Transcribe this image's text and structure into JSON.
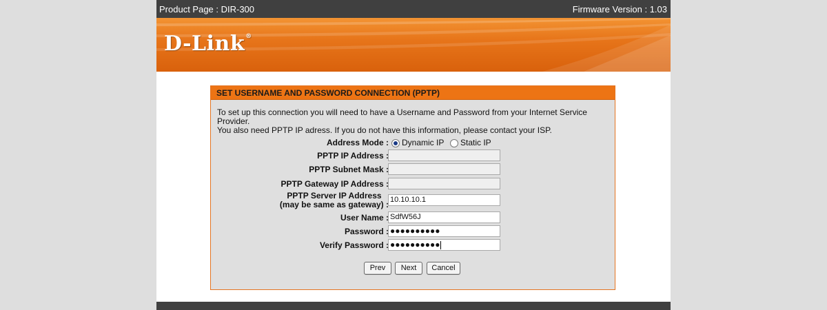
{
  "topbar": {
    "product_page": "Product Page : DIR-300",
    "firmware": "Firmware Version : 1.03"
  },
  "brand": {
    "logo_text": "D-Link",
    "logo_mark": "®",
    "accent": "#e7751a"
  },
  "panel": {
    "title": "SET USERNAME AND PASSWORD CONNECTION (PPTP)",
    "desc_line1": "To set up this connection you will need to have a Username and Password from your Internet Service Provider.",
    "desc_line2": "You also need PPTP IP adress. If you do not have this information, please contact your ISP."
  },
  "form": {
    "address_mode": {
      "label": "Address Mode :",
      "options": [
        "Dynamic IP",
        "Static IP"
      ],
      "selected": "Dynamic IP"
    },
    "pptp_ip": {
      "label": "PPTP IP Address :",
      "value": ""
    },
    "pptp_subnet": {
      "label": "PPTP Subnet Mask :",
      "value": ""
    },
    "pptp_gateway": {
      "label": "PPTP Gateway IP Address :",
      "value": ""
    },
    "pptp_server": {
      "label_line1": "PPTP Server IP Address",
      "label_line2": "(may be same as gateway) :",
      "value": "10.10.10.1"
    },
    "username": {
      "label": "User Name :",
      "value": "SdfW56J"
    },
    "password": {
      "label": "Password :",
      "value": "●●●●●●●●●●"
    },
    "verify_password": {
      "label": "Verify Password :",
      "value": "●●●●●●●●●●"
    }
  },
  "buttons": {
    "prev": "Prev",
    "next": "Next",
    "cancel": "Cancel"
  }
}
